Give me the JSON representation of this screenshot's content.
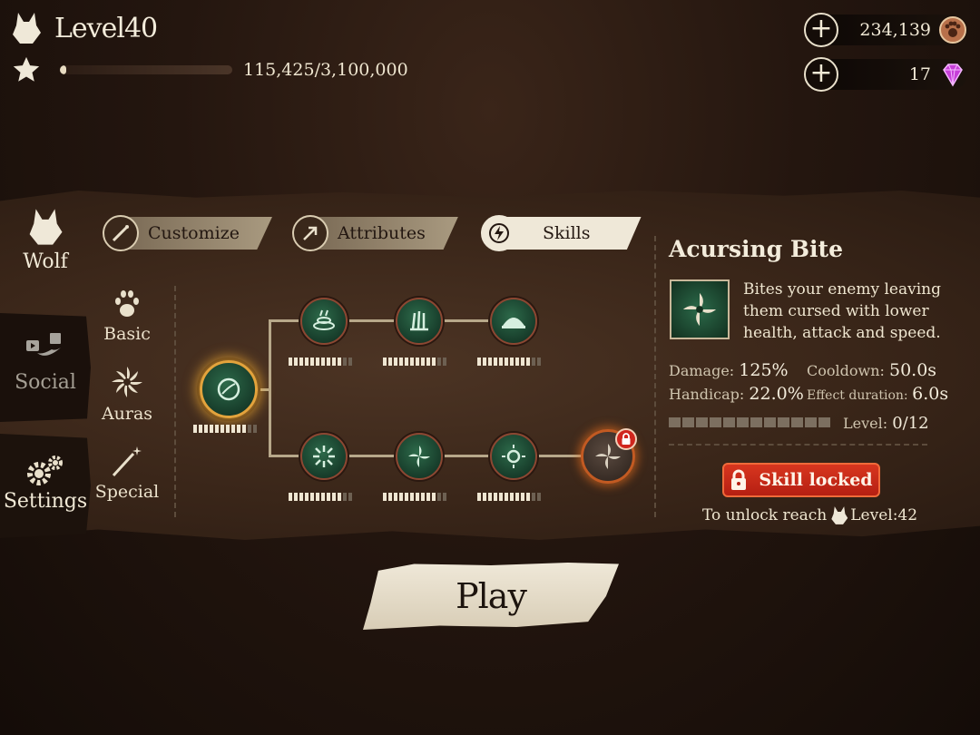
{
  "header": {
    "level_label": "Level40",
    "xp_text": "115,425/3,100,000",
    "xp_progress": 0.037,
    "coins": "234,139",
    "gems": "17"
  },
  "side_nav": {
    "wolf": "Wolf",
    "social": "Social",
    "settings": "Settings"
  },
  "categories": {
    "basic": "Basic",
    "auras": "Auras",
    "special": "Special"
  },
  "tabs": {
    "customize": "Customize",
    "attributes": "Attributes",
    "skills": "Skills",
    "active": "Skills"
  },
  "skill_tree": {
    "root": {
      "level": 0,
      "max": 12
    },
    "top_row": [
      {
        "level": 0,
        "max": 12
      },
      {
        "level": 0,
        "max": 12
      },
      {
        "level": 0,
        "max": 12
      }
    ],
    "bottom_row": [
      {
        "level": 0,
        "max": 12
      },
      {
        "level": 0,
        "max": 12
      },
      {
        "level": 0,
        "max": 12
      },
      {
        "locked": true
      }
    ]
  },
  "detail": {
    "title": "Acursing Bite",
    "description": "Bites your enemy leaving them cursed with lower health, attack and speed.",
    "damage_label": "Damage:",
    "damage_value": "125%",
    "cooldown_label": "Cooldown:",
    "cooldown_value": "50.0s",
    "handicap_label": "Handicap:",
    "handicap_value": "22.0%",
    "effect_label": "Effect duration:",
    "effect_value": "6.0s",
    "level_label": "Level:",
    "level_value": "0/12",
    "locked_button": "Skill locked",
    "unlock_prefix": "To unlock reach",
    "unlock_level": "Level:42"
  },
  "play_button": "Play",
  "colors": {
    "accent_gold": "#e3a33c",
    "locked_red": "#d0261e",
    "parchment": "#efe8d8"
  }
}
